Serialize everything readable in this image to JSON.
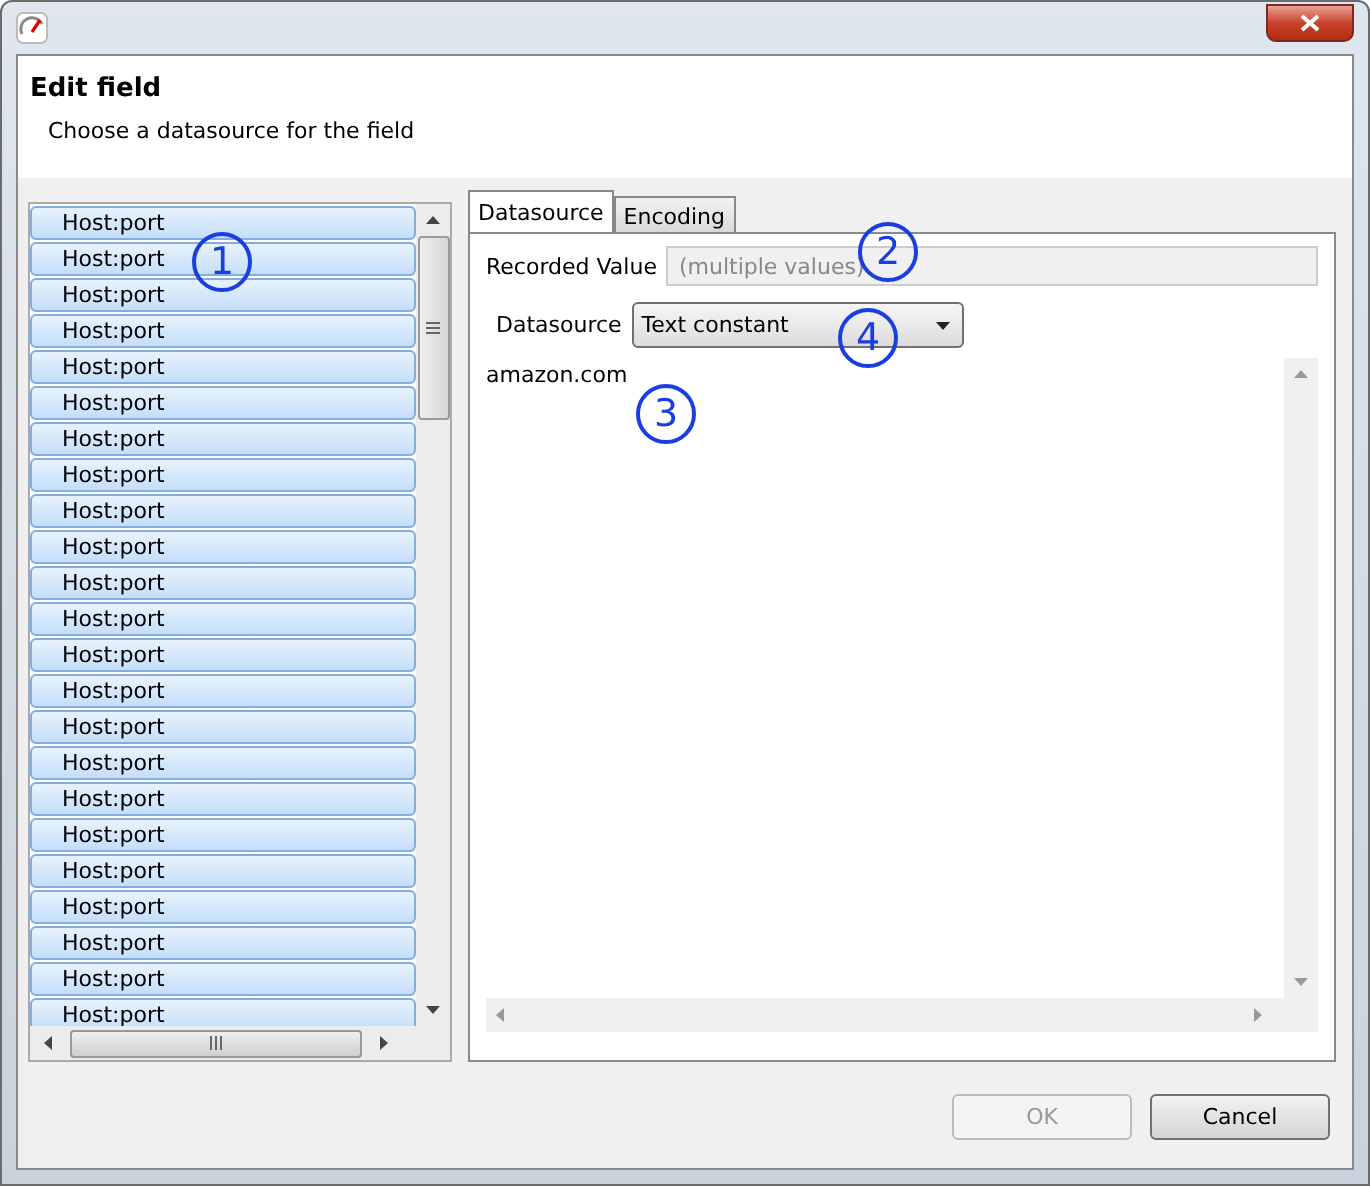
{
  "header": {
    "title": "Edit field",
    "subtitle": "Choose a datasource for the field"
  },
  "list": {
    "items": [
      {
        "label": "Host:port",
        "selected": true
      },
      {
        "label": "Host:port",
        "selected": true
      },
      {
        "label": "Host:port",
        "selected": true
      },
      {
        "label": "Host:port",
        "selected": true
      },
      {
        "label": "Host:port",
        "selected": true
      },
      {
        "label": "Host:port",
        "selected": true
      },
      {
        "label": "Host:port",
        "selected": true
      },
      {
        "label": "Host:port",
        "selected": true
      },
      {
        "label": "Host:port",
        "selected": true
      },
      {
        "label": "Host:port",
        "selected": true
      },
      {
        "label": "Host:port",
        "selected": true
      },
      {
        "label": "Host:port",
        "selected": true
      },
      {
        "label": "Host:port",
        "selected": true
      },
      {
        "label": "Host:port",
        "selected": true
      },
      {
        "label": "Host:port",
        "selected": true
      },
      {
        "label": "Host:port",
        "selected": true
      },
      {
        "label": "Host:port",
        "selected": true
      },
      {
        "label": "Host:port",
        "selected": true
      },
      {
        "label": "Host:port",
        "selected": true
      },
      {
        "label": "Host:port",
        "selected": true
      },
      {
        "label": "Host:port",
        "selected": true
      },
      {
        "label": "Host:port",
        "selected": true
      },
      {
        "label": "Host:port",
        "selected": true
      }
    ]
  },
  "tabs": [
    {
      "label": "Datasource",
      "selected": true
    },
    {
      "label": "Encoding",
      "selected": false
    }
  ],
  "recorded_value": {
    "label": "Recorded Value",
    "placeholder": "(multiple values)",
    "disabled": true
  },
  "datasource": {
    "label": "Datasource",
    "value": "Text constant"
  },
  "editor": {
    "value": "amazon.com"
  },
  "buttons": [
    {
      "label": "OK",
      "disabled": true
    },
    {
      "label": "Cancel",
      "disabled": false
    }
  ],
  "annotations": [
    "1",
    "2",
    "4",
    "3"
  ]
}
